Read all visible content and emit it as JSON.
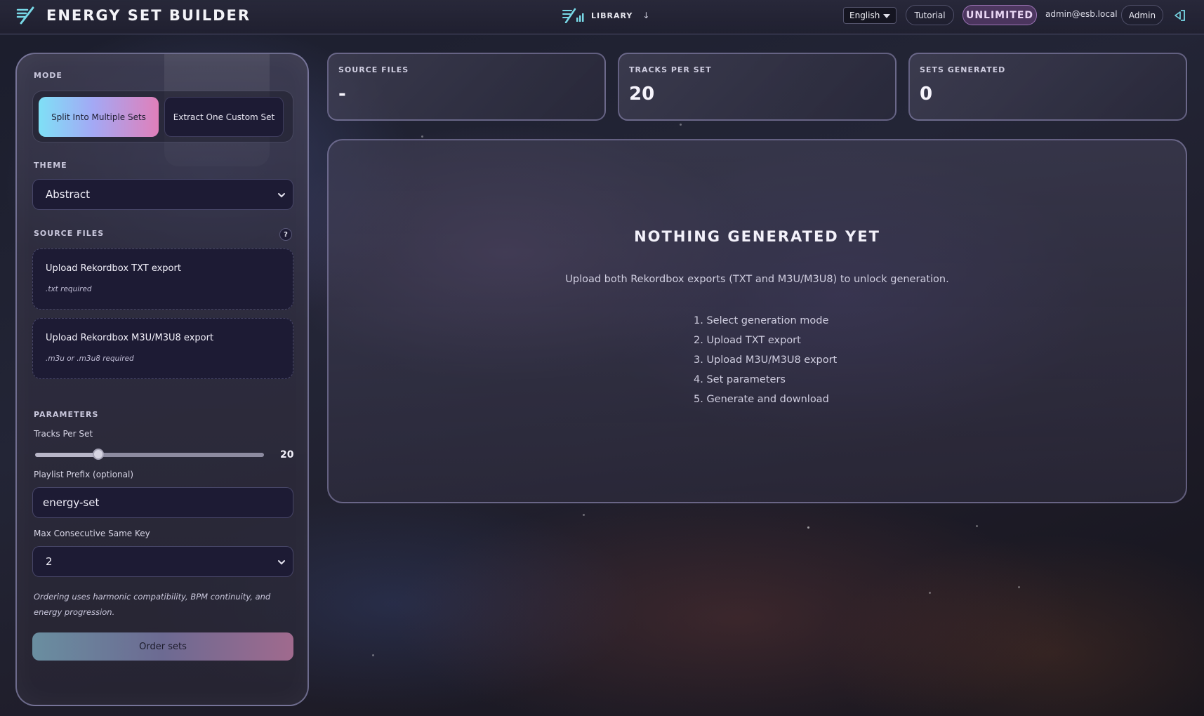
{
  "header": {
    "brand_title": "ENERGY SET BUILDER",
    "library_label": "LIBRARY",
    "library_arrow": "↓",
    "language": "English",
    "tutorial_label": "Tutorial",
    "plan_badge": "UNLIMITED",
    "user_email": "admin@esb.local",
    "admin_label": "Admin"
  },
  "sidebar": {
    "mode_label": "MODE",
    "mode_options": [
      "Split Into Multiple Sets",
      "Extract One Custom Set"
    ],
    "theme_label": "THEME",
    "theme_value": "Abstract",
    "source_files_label": "SOURCE FILES",
    "help_glyph": "?",
    "uploads": [
      {
        "title": "Upload Rekordbox TXT export",
        "hint": ".txt required"
      },
      {
        "title": "Upload Rekordbox M3U/M3U8 export",
        "hint": ".m3u or .m3u8 required"
      }
    ],
    "parameters_label": "PARAMETERS",
    "tracks_per_set_label": "Tracks Per Set",
    "tracks_per_set_value": "20",
    "playlist_prefix_label": "Playlist Prefix (optional)",
    "playlist_prefix_value": "energy-set",
    "max_same_key_label": "Max Consecutive Same Key",
    "max_same_key_value": "2",
    "ordering_note": "Ordering uses harmonic compatibility, BPM continuity, and energy progression.",
    "order_button": "Order sets"
  },
  "stats": [
    {
      "label": "SOURCE FILES",
      "value": "-"
    },
    {
      "label": "TRACKS PER SET",
      "value": "20"
    },
    {
      "label": "SETS GENERATED",
      "value": "0"
    }
  ],
  "main": {
    "empty_title": "NOTHING GENERATED YET",
    "empty_subtitle": "Upload both Rekordbox exports (TXT and M3U/M3U8) to unlock generation.",
    "steps": [
      "1. Select generation mode",
      "2. Upload TXT export",
      "3. Upload M3U/M3U8 export",
      "4. Set parameters",
      "5. Generate and download"
    ]
  },
  "colors": {
    "accent_gradient_start": "#7fe0f6",
    "accent_gradient_end": "#e07fba",
    "panel_dark": "#1d1b34",
    "badge_purple": "#6e4682"
  }
}
